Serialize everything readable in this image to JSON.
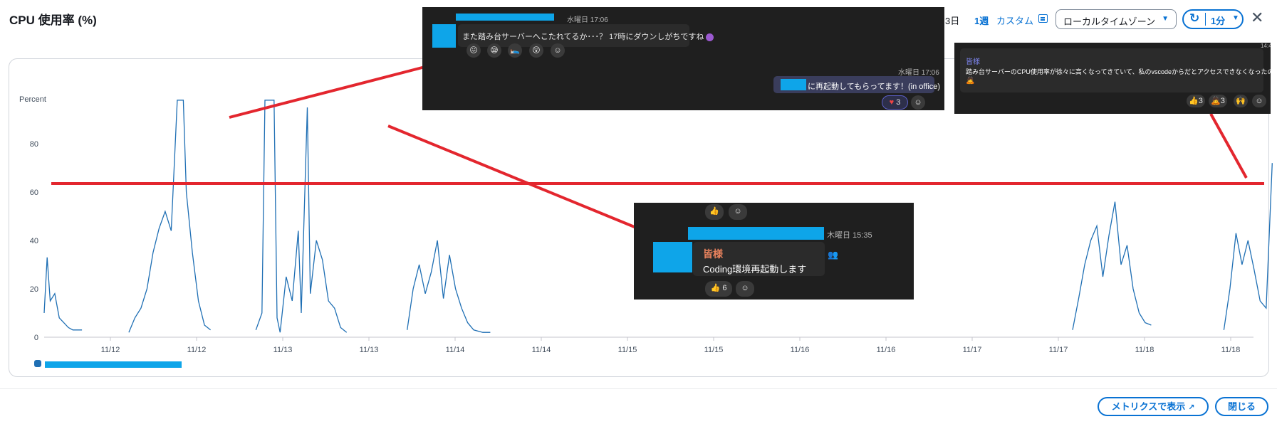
{
  "modal": {
    "title": "CPU 使用率 (%)",
    "close_glyph": "✕"
  },
  "toolbar": {
    "range_3d": "3日",
    "range_1w": "1週",
    "range_custom": "カスタム",
    "timezone": "ローカルタイムゾーン",
    "interval": "1分"
  },
  "footer": {
    "metrics_button": "メトリクスで表示",
    "close_button": "閉じる"
  },
  "chart_data": {
    "type": "line",
    "ylabel": "Percent",
    "y_ticks": [
      0,
      20,
      40,
      60,
      80
    ],
    "x_ticks": [
      "11/12",
      "11/12",
      "11/13",
      "11/13",
      "11/14",
      "11/14",
      "11/15",
      "11/15",
      "11/16",
      "11/16",
      "11/17",
      "11/17",
      "11/18",
      "11/18"
    ],
    "ylim": [
      0,
      100
    ],
    "grid": false,
    "threshold_annotation": 70,
    "series": [
      {
        "color": "#1f6fb4",
        "segments": [
          [
            [
              0.0,
              10
            ],
            [
              0.02,
              33
            ],
            [
              0.04,
              15
            ],
            [
              0.07,
              18
            ],
            [
              0.1,
              8
            ],
            [
              0.13,
              6
            ],
            [
              0.16,
              4
            ],
            [
              0.19,
              3
            ],
            [
              0.22,
              3
            ],
            [
              0.25,
              3
            ]
          ],
          [
            [
              0.56,
              2
            ],
            [
              0.6,
              8
            ],
            [
              0.64,
              12
            ],
            [
              0.68,
              20
            ],
            [
              0.72,
              35
            ],
            [
              0.76,
              45
            ],
            [
              0.8,
              52
            ],
            [
              0.84,
              44
            ],
            [
              0.88,
              98
            ],
            [
              0.92,
              98
            ],
            [
              0.94,
              60
            ],
            [
              0.98,
              35
            ],
            [
              1.02,
              15
            ],
            [
              1.06,
              5
            ],
            [
              1.1,
              3
            ]
          ],
          [
            [
              1.4,
              3
            ],
            [
              1.44,
              10
            ],
            [
              1.46,
              98
            ],
            [
              1.52,
              98
            ],
            [
              1.54,
              8
            ],
            [
              1.56,
              2
            ],
            [
              1.6,
              25
            ],
            [
              1.64,
              15
            ],
            [
              1.68,
              44
            ],
            [
              1.7,
              10
            ],
            [
              1.74,
              95
            ],
            [
              1.76,
              18
            ],
            [
              1.8,
              40
            ],
            [
              1.84,
              32
            ],
            [
              1.88,
              15
            ],
            [
              1.92,
              12
            ],
            [
              1.96,
              4
            ],
            [
              2.0,
              2
            ]
          ],
          [
            [
              2.4,
              3
            ],
            [
              2.44,
              20
            ],
            [
              2.48,
              30
            ],
            [
              2.52,
              18
            ],
            [
              2.56,
              27
            ],
            [
              2.6,
              40
            ],
            [
              2.64,
              16
            ],
            [
              2.68,
              34
            ],
            [
              2.72,
              20
            ],
            [
              2.76,
              12
            ],
            [
              2.8,
              6
            ],
            [
              2.84,
              3
            ],
            [
              2.9,
              2
            ],
            [
              2.95,
              2
            ]
          ],
          [
            [
              6.8,
              3
            ],
            [
              6.84,
              16
            ],
            [
              6.88,
              30
            ],
            [
              6.92,
              40
            ],
            [
              6.96,
              46
            ],
            [
              7.0,
              25
            ],
            [
              7.04,
              42
            ],
            [
              7.08,
              56
            ],
            [
              7.12,
              30
            ],
            [
              7.16,
              38
            ],
            [
              7.2,
              20
            ],
            [
              7.24,
              10
            ],
            [
              7.28,
              6
            ],
            [
              7.32,
              5
            ]
          ],
          [
            [
              7.8,
              3
            ],
            [
              7.84,
              20
            ],
            [
              7.88,
              43
            ],
            [
              7.92,
              30
            ],
            [
              7.96,
              40
            ],
            [
              8.0,
              28
            ],
            [
              8.04,
              15
            ],
            [
              8.08,
              12
            ],
            [
              8.12,
              72
            ]
          ]
        ]
      }
    ]
  },
  "overlays": {
    "chat1": {
      "time": "水曜日 17:06",
      "message": "また踏み台サーバーへこたれてるか･･･？ 17時にダウンしがちですね",
      "reply_time": "水曜日 17:06",
      "reply_text": "に再起動してもらってます！(in office)",
      "reaction_count": "3"
    },
    "chat2": {
      "time": "木曜日 15:35",
      "mention": "皆様",
      "message": "Coding環境再起動します",
      "reaction_count": "6"
    },
    "chat3": {
      "time_partial": "14:4",
      "mention": "皆様",
      "message": "踏み台サーバーのCPU使用率が徐々に高くなってきていて、私のvscodeからだとアクセスできなくなったので一度再起動します。",
      "reaction_count_1": "3",
      "reaction_count_2": "3"
    }
  },
  "colors": {
    "accent": "#0972d3",
    "series": "#1f6fb4",
    "annotation": "#e3262e",
    "overlay_bg": "#1f1f1f",
    "redaction": "#0ea5e9"
  }
}
